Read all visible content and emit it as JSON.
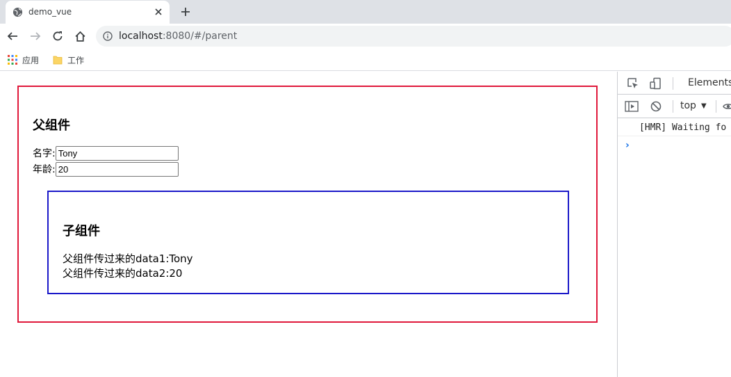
{
  "browser": {
    "tab": {
      "title": "demo_vue"
    },
    "url": {
      "host": "localhost",
      "rest": ":8080/#/parent"
    },
    "bookmarks": [
      {
        "label": "应用",
        "icon": "apps-grid-icon"
      },
      {
        "label": "工作",
        "icon": "folder-icon"
      }
    ]
  },
  "parent": {
    "title": "父组件",
    "name_label": "名字:",
    "name_value": "Tony",
    "age_label": "年龄:",
    "age_value": "20"
  },
  "child": {
    "title": "子组件",
    "line1": "父组件传过来的data1:Tony",
    "line2": "父组件传过来的data2:20"
  },
  "devtools": {
    "tab_elements": "Elements",
    "context": "top",
    "console_message": "[HMR] Waiting fo",
    "prompt": "›"
  },
  "colors": {
    "parent_border": "#e0183a",
    "child_border": "#1a18c9"
  }
}
